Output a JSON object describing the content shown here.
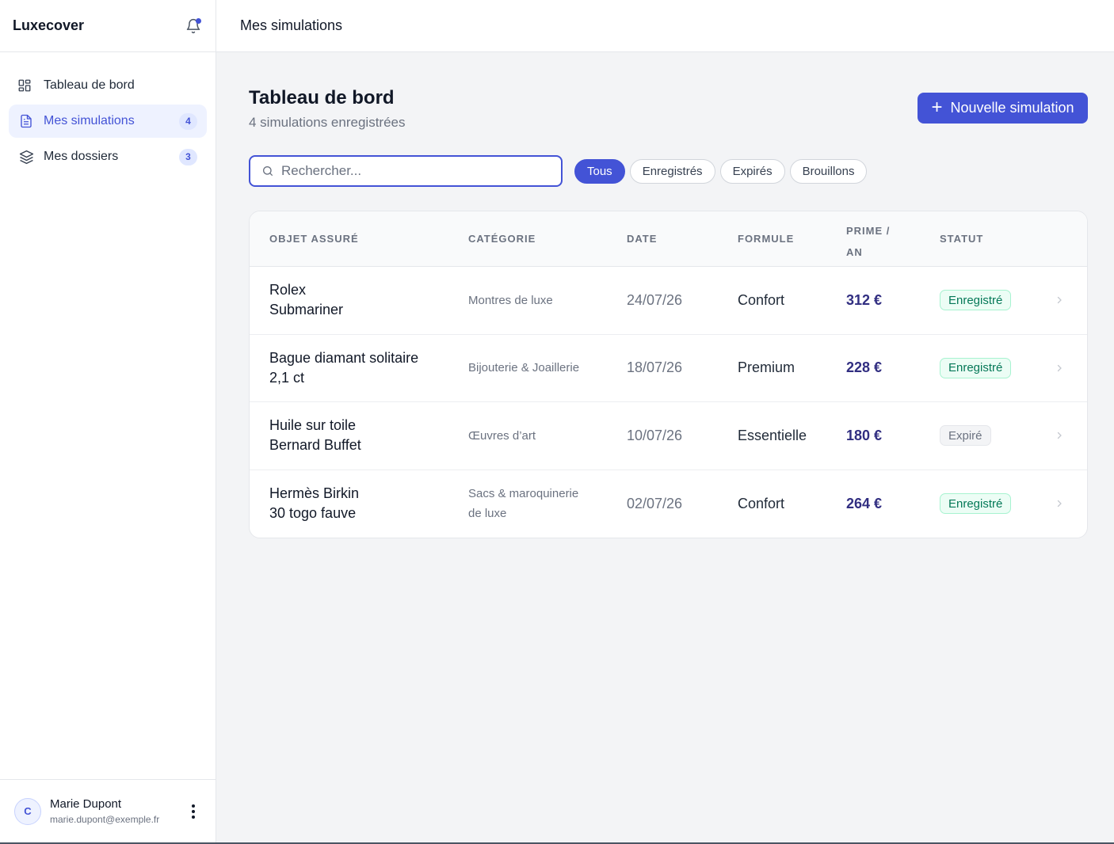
{
  "app": {
    "name": "Luxecover"
  },
  "topbar": {
    "title": "Mes simulations"
  },
  "sidebar": {
    "items": [
      {
        "label": "Tableau de bord",
        "icon": "grid-icon",
        "badge": ""
      },
      {
        "label": "Mes simulations",
        "icon": "document-icon",
        "badge": "4"
      },
      {
        "label": "Mes dossiers",
        "icon": "layers-icon",
        "badge": "3"
      }
    ]
  },
  "user": {
    "initial": "C",
    "name": "Marie Dupont",
    "email": "marie.dupont@exemple.fr"
  },
  "page": {
    "title": "Tableau de bord",
    "subtitle": "4 simulations enregistrées",
    "new_button": "Nouvelle simulation"
  },
  "search": {
    "placeholder": "Rechercher...",
    "value": ""
  },
  "filters": [
    "Tous",
    "Enregistrés",
    "Expirés",
    "Brouillons"
  ],
  "table": {
    "headers": {
      "object": "OBJET ASSURÉ",
      "category": "CATÉGORIE",
      "date": "DATE",
      "formula": "FORMULE",
      "prime_1": "PRIME /",
      "prime_2": "AN",
      "status": "STATUT"
    },
    "rows": [
      {
        "object_1": "Rolex",
        "object_2": "Submariner",
        "category_1": "Montres de luxe",
        "category_2": "",
        "date": "24/07/26",
        "formula": "Confort",
        "prime": "312 €",
        "status": "Enregistré"
      },
      {
        "object_1": "Bague diamant solitaire",
        "object_2": "2,1 ct",
        "category_1": "Bijouterie & Joaillerie",
        "category_2": "",
        "date": "18/07/26",
        "formula": "Premium",
        "prime": "228 €",
        "status": "Enregistré"
      },
      {
        "object_1": "Huile sur toile",
        "object_2": "Bernard Buffet",
        "category_1": "Œuvres d’art",
        "category_2": "",
        "date": "10/07/26",
        "formula": "Essentielle",
        "prime": "180 €",
        "status": "Expiré"
      },
      {
        "object_1": "Hermès Birkin",
        "object_2": "30 togo fauve",
        "category_1": "Sacs & maroquinerie",
        "category_2": "de luxe",
        "date": "02/07/26",
        "formula": "Confort",
        "prime": "264 €",
        "status": "Enregistré"
      }
    ]
  },
  "colors": {
    "accent": "#4353d6",
    "success": "#047857",
    "muted": "#6b7280"
  }
}
